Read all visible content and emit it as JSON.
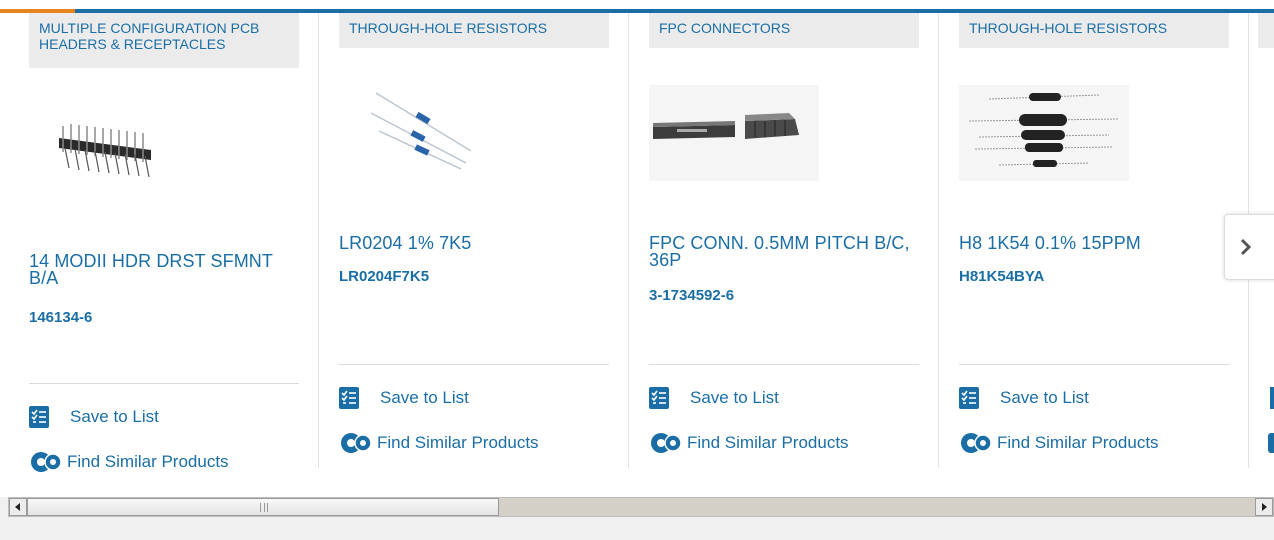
{
  "colors": {
    "accent": "#1a6ea5",
    "highlight": "#e8841e",
    "category_bg": "#ebebeb"
  },
  "products": [
    {
      "category": "MULTIPLE CONFIGURATION PCB HEADERS & RECEPTACLES",
      "name": "14 MODII HDR DRST SFMNT B/A",
      "part_number": "146134-6",
      "image": "pin-header-image"
    },
    {
      "category": "THROUGH-HOLE RESISTORS",
      "name": "LR0204 1% 7K5",
      "part_number": "LR0204F7K5",
      "image": "resistor-image"
    },
    {
      "category": "FPC CONNECTORS",
      "name": "FPC CONN. 0.5MM PITCH B/C, 36P",
      "part_number": "3-1734592-6",
      "image": "fpc-connector-image"
    },
    {
      "category": "THROUGH-HOLE RESISTORS",
      "name": "H8 1K54 0.1% 15PPM",
      "part_number": "H81K54BYA",
      "image": "resistors-black-image"
    }
  ],
  "actions": {
    "save_label": "Save to List",
    "similar_label": "Find Similar Products",
    "save_icon": "checklist-icon",
    "similar_icon": "gears-icon"
  },
  "carousel": {
    "next_icon": "chevron-right-icon"
  },
  "scrollbar": {
    "left_icon": "arrow-left-icon",
    "right_icon": "arrow-right-icon"
  }
}
